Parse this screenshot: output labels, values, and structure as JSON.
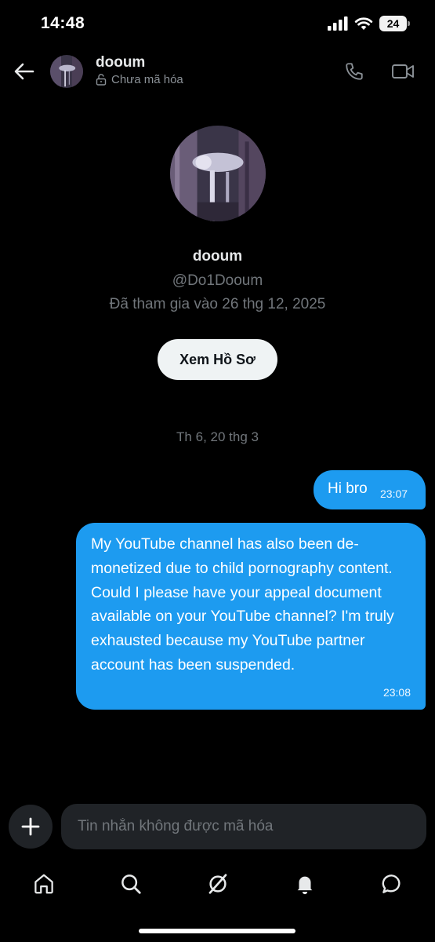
{
  "status_bar": {
    "time": "14:48",
    "battery": "24"
  },
  "header": {
    "name": "dooum",
    "encryption": "Chưa mã hóa"
  },
  "profile": {
    "name": "dooum",
    "handle": "@Do1Dooum",
    "joined": "Đã tham gia vào 26 thg 12, 2025",
    "view_profile_label": "Xem Hồ Sơ"
  },
  "conversation": {
    "date_separator": "Th 6, 20 thg 3",
    "messages": [
      {
        "text": "Hi bro",
        "time": "23:07"
      },
      {
        "text": "My YouTube channel has also been de-monetized due to child pornography content. Could I please have your appeal document available on your YouTube channel? I'm truly exhausted because my YouTube partner account has been suspended.",
        "time": "23:08"
      }
    ]
  },
  "composer": {
    "placeholder": "Tin nhắn không được mã hóa"
  },
  "tabs": [
    "home-icon",
    "search-icon",
    "grok-icon",
    "notifications-icon",
    "messages-icon"
  ],
  "colors": {
    "accent": "#1d9bf0",
    "background": "#000000",
    "muted": "#71767b"
  }
}
